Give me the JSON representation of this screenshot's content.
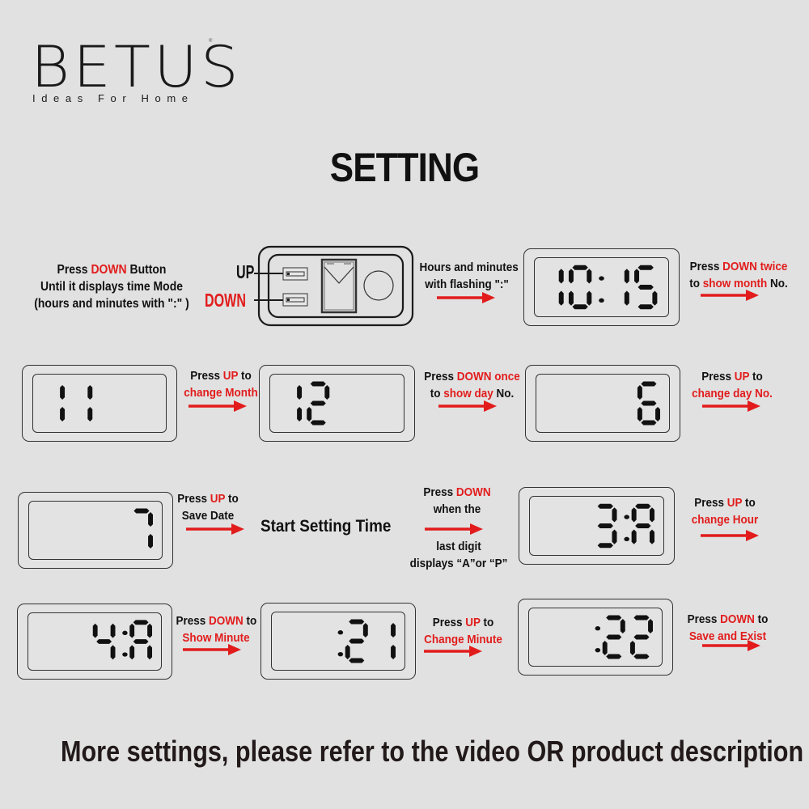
{
  "brand": {
    "name": "BETUS",
    "registered": "®",
    "tagline": "Ideas For Home"
  },
  "title": "SETTING",
  "colors": {
    "background": "#e1e1e1",
    "accent": "#e21c1c",
    "text": "#111111",
    "lcd_segment": "#111111"
  },
  "device": {
    "up_label": "UP",
    "down_label": "DOWN"
  },
  "intro": {
    "line1_pre": "Press ",
    "line1_red": "DOWN",
    "line1_post": " Button",
    "line2": "Until it displays time Mode",
    "line3": "(hours and minutes with \":\" )"
  },
  "steps": [
    {
      "id": "s1",
      "display": "10:15",
      "caption_before": [
        [
          "Hours and minutes",
          ""
        ],
        [
          "with flashing \":\"",
          ""
        ]
      ]
    },
    {
      "id": "s2",
      "display": "11",
      "caption": [
        [
          [
            "Press ",
            "k"
          ],
          [
            "DOWN twice",
            "r"
          ]
        ],
        [
          [
            "to ",
            "k"
          ],
          [
            "show month",
            "r"
          ],
          [
            " No.",
            "k"
          ]
        ]
      ]
    },
    {
      "id": "s3",
      "display": "12",
      "caption": [
        [
          [
            "Press ",
            "k"
          ],
          [
            "UP",
            "r"
          ],
          [
            " to",
            "k"
          ]
        ],
        [
          [
            "change Month",
            "r"
          ]
        ]
      ]
    },
    {
      "id": "s4",
      "display": "6",
      "caption": [
        [
          [
            "Press ",
            "k"
          ],
          [
            "DOWN once",
            "r"
          ]
        ],
        [
          [
            "to ",
            "k"
          ],
          [
            "show day",
            "r"
          ],
          [
            " No.",
            "k"
          ]
        ]
      ]
    },
    {
      "id": "s5",
      "display": "7",
      "caption": [
        [
          [
            "Press ",
            "k"
          ],
          [
            "UP",
            "r"
          ],
          [
            " to",
            "k"
          ]
        ],
        [
          [
            "change day No.",
            "r"
          ]
        ]
      ]
    },
    {
      "id": "s6",
      "display": "3:A",
      "caption": [
        [
          [
            "Press ",
            "k"
          ],
          [
            "UP",
            "r"
          ],
          [
            " to",
            "k"
          ]
        ],
        [
          [
            "Save Date",
            "k"
          ]
        ]
      ]
    },
    {
      "id": "s7",
      "display": "4:A",
      "caption": [
        [
          [
            "Press ",
            "k"
          ],
          [
            "DOWN",
            "r"
          ]
        ],
        [
          [
            "when the",
            "k"
          ]
        ]
      ],
      "caption_below": [
        "last digit",
        "displays “A”or “P”"
      ]
    },
    {
      "id": "s8",
      "display": ":21",
      "caption": [
        [
          [
            "Press ",
            "k"
          ],
          [
            "UP",
            "r"
          ],
          [
            " to",
            "k"
          ]
        ],
        [
          [
            "change Hour",
            "r"
          ]
        ]
      ]
    },
    {
      "id": "s9",
      "display": ":22",
      "caption": [
        [
          [
            "Press ",
            "k"
          ],
          [
            "DOWN",
            "r"
          ],
          [
            " to",
            "k"
          ]
        ],
        [
          [
            "Show Minute",
            "r"
          ]
        ]
      ]
    }
  ],
  "captions": {
    "c1": {
      "l1": "Hours and minutes",
      "l2": "with flashing \":\""
    },
    "c2": {
      "l1a": "Press ",
      "l1b": "DOWN twice",
      "l2a": "to ",
      "l2b": "show month",
      "l2c": " No."
    },
    "c3": {
      "l1a": "Press ",
      "l1b": "UP",
      "l1c": " to",
      "l2": "change Month"
    },
    "c4": {
      "l1a": "Press ",
      "l1b": "DOWN once",
      "l2a": "to ",
      "l2b": "show day",
      "l2c": " No."
    },
    "c5": {
      "l1a": "Press ",
      "l1b": "UP",
      "l1c": " to",
      "l2": "change day No."
    },
    "c6": {
      "l1a": "Press ",
      "l1b": "UP",
      "l1c": " to",
      "l2": "Save Date"
    },
    "c7": {
      "l1a": "Press ",
      "l1b": "DOWN",
      "l2": "when the",
      "l3": "last digit",
      "l4": "displays “A”or “P”"
    },
    "c8": {
      "l1a": "Press ",
      "l1b": "UP",
      "l1c": " to",
      "l2": "change Hour"
    },
    "c9": {
      "l1a": "Press ",
      "l1b": "DOWN",
      "l1c": " to",
      "l2": "Show Minute"
    },
    "c10": {
      "l1a": "Press ",
      "l1b": "UP",
      "l1c": " to",
      "l2": "Change Minute"
    },
    "c11": {
      "l1a": "Press ",
      "l1b": "DOWN",
      "l1c": " to",
      "l2": "Save and Exist"
    }
  },
  "start_setting_time": "Start Setting Time",
  "displays": {
    "d1": "10:15",
    "d2": "11",
    "d3": "12",
    "d4": "6",
    "d5": "7",
    "d6": "3:A",
    "d7": "4:A",
    "d8": ":21",
    "d9": ":22"
  },
  "footer": "More settings, please refer to the video OR product description"
}
